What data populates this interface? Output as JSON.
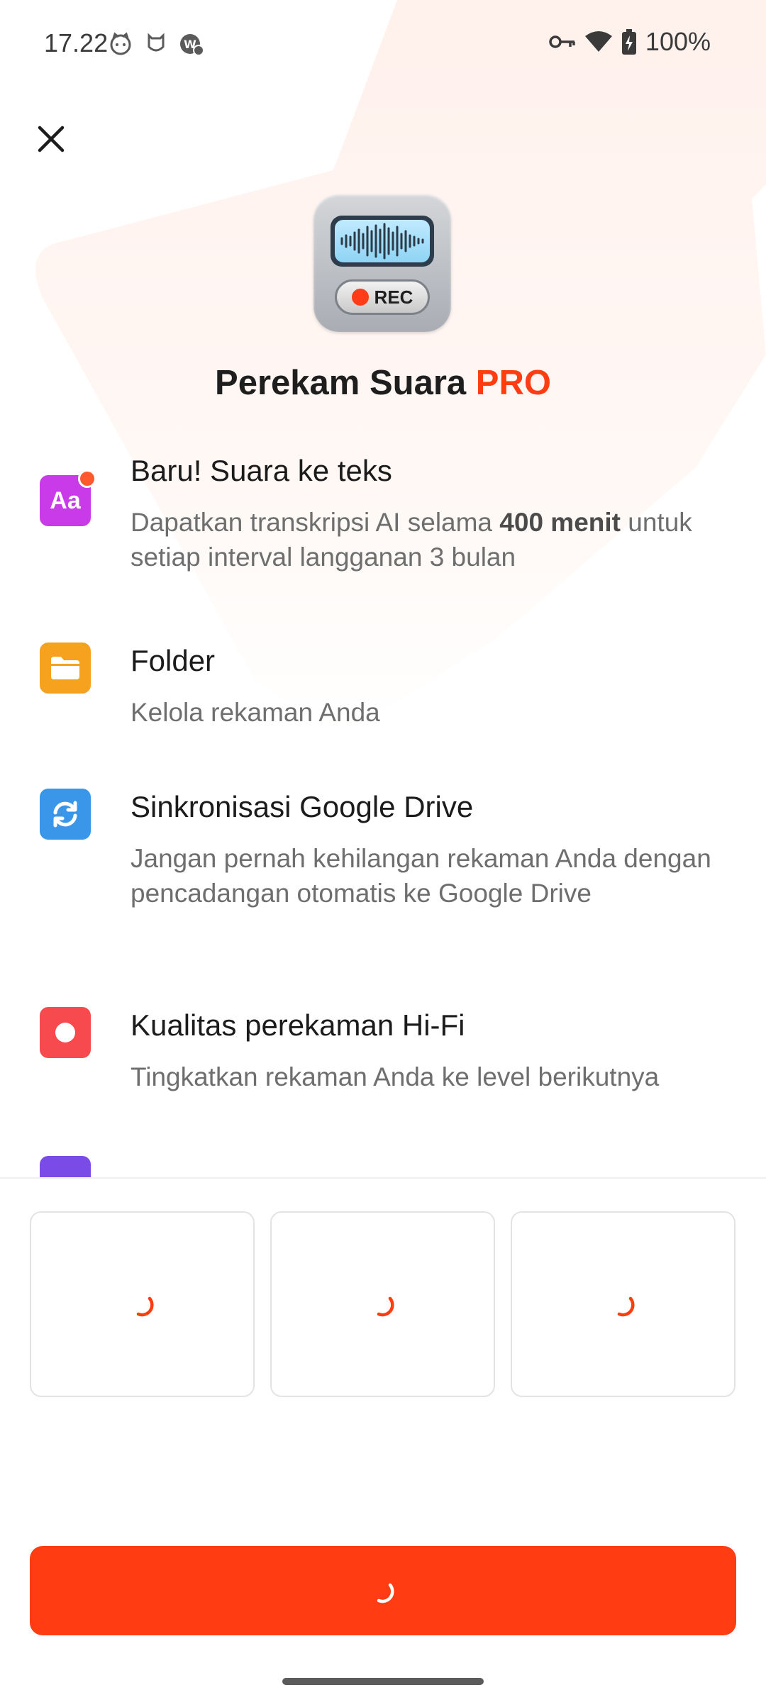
{
  "status_bar": {
    "time": "17.22",
    "battery": "100%"
  },
  "app": {
    "name": "Perekam Suara",
    "badge": "PRO",
    "logo_label": "REC"
  },
  "features": [
    {
      "icon": "text-aa-icon",
      "color": "#c93ae8",
      "title": "Baru! Suara ke teks",
      "desc_pre": "Dapatkan transkripsi AI selama ",
      "desc_bold": "400 menit",
      "desc_post": " untuk setiap interval langganan 3 bulan"
    },
    {
      "icon": "folder-icon",
      "color": "#f6a21e",
      "title": "Folder",
      "desc": "Kelola rekaman Anda"
    },
    {
      "icon": "sync-icon",
      "color": "#3a96e8",
      "title": "Sinkronisasi Google Drive",
      "desc": "Jangan pernah kehilangan rekaman Anda dengan pencadangan otomatis ke Google Drive"
    },
    {
      "icon": "record-icon",
      "color": "#f64a4f",
      "title": "Kualitas perekaman Hi-Fi",
      "desc": "Tingkatkan rekaman Anda ke level berikutnya"
    }
  ],
  "accent_color": "#ff3c12",
  "plans": [
    {
      "state": "loading"
    },
    {
      "state": "loading"
    },
    {
      "state": "loading"
    }
  ],
  "cta": {
    "state": "loading"
  }
}
